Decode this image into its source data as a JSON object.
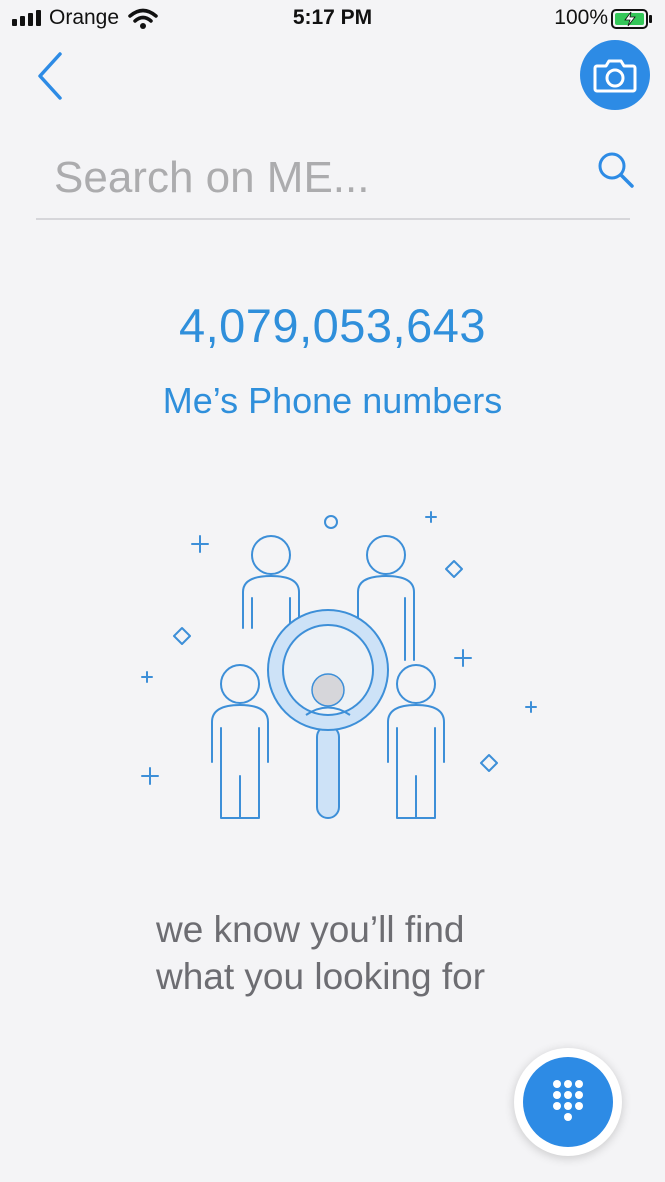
{
  "status_bar": {
    "carrier": "Orange",
    "time": "5:17 PM",
    "battery_percent": "100%",
    "icons": [
      "signal-icon",
      "wifi-icon",
      "battery-charging-icon"
    ]
  },
  "header": {
    "back_icon": "chevron-left-icon",
    "camera_icon": "camera-icon"
  },
  "search": {
    "placeholder": "Search on ME...",
    "value": "",
    "icon": "search-icon"
  },
  "stats": {
    "count": "4,079,053,643",
    "label": "Me’s Phone numbers"
  },
  "illustration": {
    "icon": "people-search-icon"
  },
  "tagline": {
    "line1": "we know you’ll find",
    "line2": "what you looking for"
  },
  "fab": {
    "icon": "dialpad-icon"
  },
  "colors": {
    "accent": "#2d8be5",
    "text_accent": "#2f8fdb",
    "background": "#f4f4f6",
    "muted_text": "#6d6d72"
  }
}
